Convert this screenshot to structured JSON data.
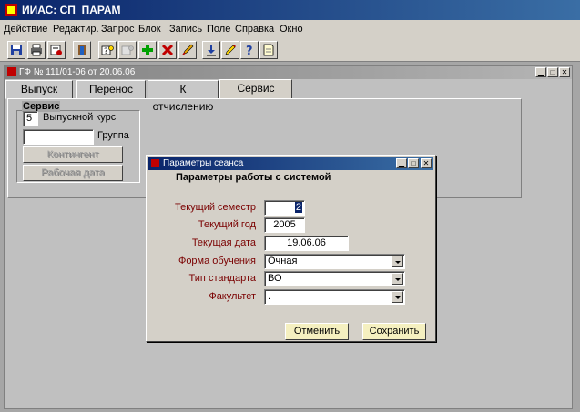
{
  "app": {
    "title": "ИИАС: СП_ПАРАМ"
  },
  "menu": [
    "Действие",
    "Редактир.",
    "Запрос",
    "Блок",
    "Запись",
    "Поле",
    "Справка",
    "Окно"
  ],
  "form_window": {
    "title": "ГФ № 111/01-06 от 20.06.06"
  },
  "tabs": [
    "Выпуск",
    "Перенос",
    "К отчислению",
    "Сервис"
  ],
  "service_panel": {
    "group_title": "Сервис",
    "course_value": "5",
    "course_label": "Выпускной курс",
    "group_value": "",
    "group_label": "Группа",
    "contingent_button": "Контингент",
    "workdate_button": "Рабочая дата"
  },
  "dialog": {
    "title": "Параметры сеанса",
    "heading": "Параметры работы с системой",
    "semester_label": "Текущий семестр",
    "semester_value": "2",
    "year_label": "Текущий год",
    "year_value": "2005",
    "date_label": "Текущая дата",
    "date_value": "19.06.06",
    "study_form_label": "Форма обучения",
    "study_form_value": "Очная",
    "standard_label": "Тип стандарта",
    "standard_value": "ВО",
    "faculty_label": "Факультет",
    "faculty_value": ".",
    "cancel_button": "Отменить",
    "save_button": "Сохранить"
  },
  "icons": [
    "save-icon",
    "print-icon",
    "print-preview-icon",
    "exit-icon",
    "query-icon",
    "query-disabled-icon",
    "insert-record-icon",
    "delete-record-icon",
    "edit-icon",
    "download-icon",
    "pencil-icon",
    "help-icon",
    "document-icon"
  ]
}
